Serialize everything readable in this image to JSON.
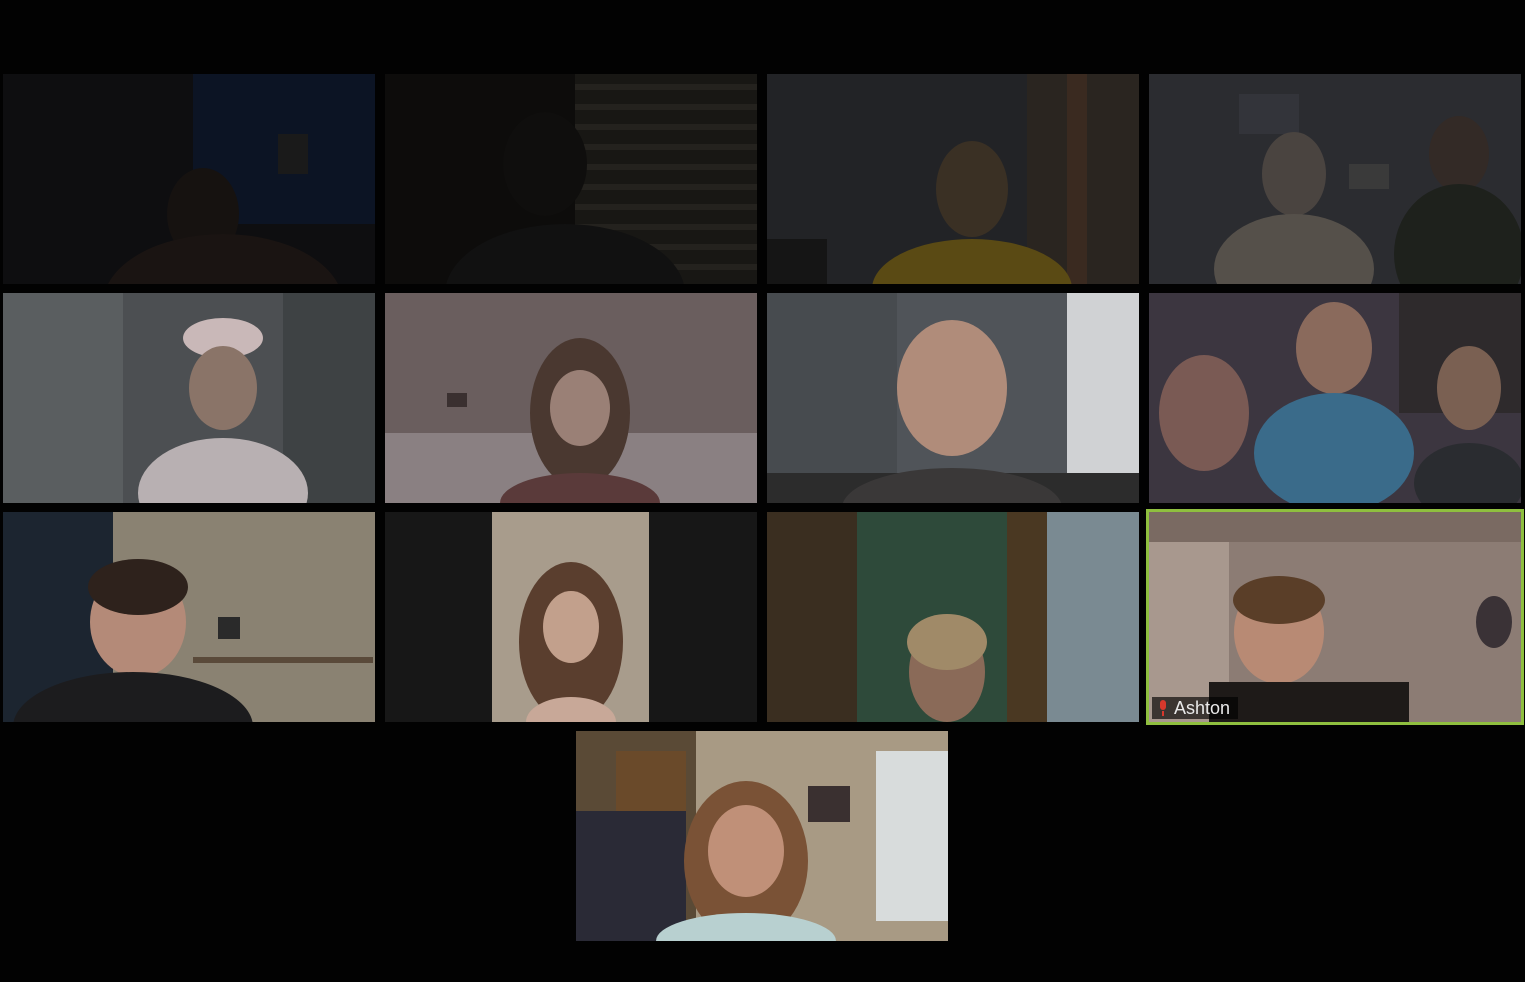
{
  "app": {
    "view": "gallery"
  },
  "colors": {
    "background": "#020202",
    "active_speaker_border": "#8fbf3f",
    "muted_icon": "#d8382c"
  },
  "participants": [
    {
      "name": "",
      "shown_name": "",
      "video": "dark-room-girl"
    },
    {
      "name": "",
      "shown_name": "",
      "video": "dark-room-blinds"
    },
    {
      "name": "",
      "shown_name": "",
      "video": "yellow-shirt"
    },
    {
      "name": "",
      "shown_name": "",
      "video": "two-people-couch"
    },
    {
      "name": "",
      "shown_name": "",
      "video": "girl-white-cap"
    },
    {
      "name": "",
      "shown_name": "",
      "video": "girl-long-hair-bed"
    },
    {
      "name": "",
      "shown_name": "",
      "video": "man-smiling"
    },
    {
      "name": "",
      "shown_name": "",
      "video": "three-kids"
    },
    {
      "name": "",
      "shown_name": "",
      "video": "glasses-kitchen"
    },
    {
      "name": "",
      "shown_name": "",
      "video": "portrait-long-hair"
    },
    {
      "name": "",
      "shown_name": "",
      "video": "green-room"
    },
    {
      "name": "Ashton",
      "shown_name": "Ashton",
      "video": "boy-headset",
      "active_speaker": true,
      "muted": true
    },
    {
      "name": "",
      "shown_name": "",
      "video": "girl-smiling-bedroom"
    }
  ]
}
